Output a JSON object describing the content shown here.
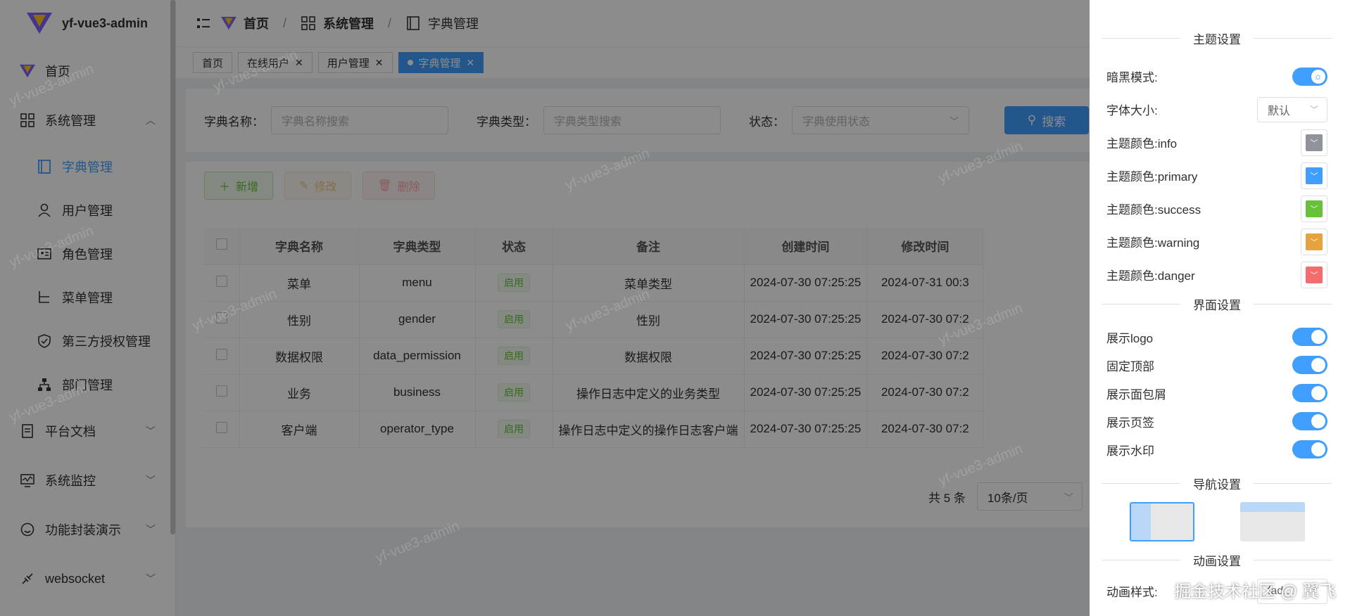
{
  "app": {
    "title": "yf-vue3-admin",
    "watermark": "yf-vue3-admin"
  },
  "sidebar": {
    "home": "首页",
    "system": "系统管理",
    "sub": [
      "字典管理",
      "用户管理",
      "角色管理",
      "菜单管理",
      "第三方授权管理",
      "部门管理"
    ],
    "docs": "平台文档",
    "monitor": "系统监控",
    "demo": "功能封装演示",
    "ws": "websocket"
  },
  "breadcrumb": [
    "首页",
    "系统管理",
    "字典管理"
  ],
  "tabs": [
    {
      "label": "首页"
    },
    {
      "label": "在线用户"
    },
    {
      "label": "用户管理"
    },
    {
      "label": "字典管理"
    }
  ],
  "search": {
    "name_label": "字典名称：",
    "name_placeholder": "字典名称搜索",
    "type_label": "字典类型：",
    "type_placeholder": "字典类型搜索",
    "status_label": "状态：",
    "status_placeholder": "字典使用状态",
    "search_button": "搜索"
  },
  "toolbar": {
    "add": "新增",
    "edit": "修改",
    "delete": "删除"
  },
  "table": {
    "columns": [
      "字典名称",
      "字典类型",
      "状态",
      "备注",
      "创建时间",
      "修改时间"
    ],
    "rows": [
      {
        "name": "菜单",
        "type": "menu",
        "status": "启用",
        "remark": "菜单类型",
        "created": "2024-07-30 07:25:25",
        "modified": "2024-07-31 00:3"
      },
      {
        "name": "性别",
        "type": "gender",
        "status": "启用",
        "remark": "性别",
        "created": "2024-07-30 07:25:25",
        "modified": "2024-07-30 07:2"
      },
      {
        "name": "数据权限",
        "type": "data_permission",
        "status": "启用",
        "remark": "数据权限",
        "created": "2024-07-30 07:25:25",
        "modified": "2024-07-30 07:2"
      },
      {
        "name": "业务",
        "type": "business",
        "status": "启用",
        "remark": "操作日志中定义的业务类型",
        "created": "2024-07-30 07:25:25",
        "modified": "2024-07-30 07:2"
      },
      {
        "name": "客户端",
        "type": "operator_type",
        "status": "启用",
        "remark": "操作日志中定义的操作日志客户端",
        "created": "2024-07-30 07:25:25",
        "modified": "2024-07-30 07:2"
      }
    ]
  },
  "pager": {
    "total": "共 5 条",
    "size": "10条/页"
  },
  "drawer": {
    "theme_title": "主题设置",
    "dark_label": "暗黑模式:",
    "font_label": "字体大小:",
    "font_value": "默认",
    "colors": [
      {
        "label": "主题颜色:info",
        "color": "#909399"
      },
      {
        "label": "主题颜色:primary",
        "color": "#409eff"
      },
      {
        "label": "主题颜色:success",
        "color": "#67c23a"
      },
      {
        "label": "主题颜色:warning",
        "color": "#e6a23c"
      },
      {
        "label": "主题颜色:danger",
        "color": "#f56c6c"
      }
    ],
    "ui_title": "界面设置",
    "switches": [
      "展示logo",
      "固定顶部",
      "展示面包屑",
      "展示页签",
      "展示水印"
    ],
    "nav_title": "导航设置",
    "anim_title": "动画设置",
    "anim_label": "动画样式:",
    "anim_value": "fad..."
  },
  "credit": "掘金技术社区 @ 翼飞"
}
